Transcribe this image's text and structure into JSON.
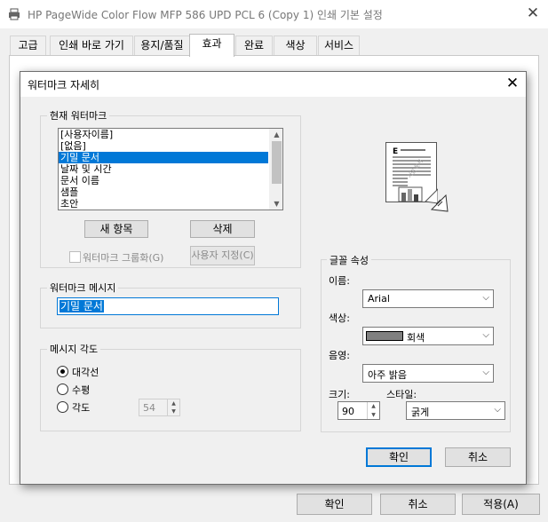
{
  "window": {
    "title": "HP PageWide Color Flow MFP 586 UPD PCL 6 (Copy 1) 인쇄 기본 설정",
    "close_glyph": "✕"
  },
  "tabs": [
    {
      "label": "고급"
    },
    {
      "label": "인쇄 바로 가기"
    },
    {
      "label": "용지/품질"
    },
    {
      "label": "효과"
    },
    {
      "label": "완료"
    },
    {
      "label": "색상"
    },
    {
      "label": "서비스"
    }
  ],
  "footer": {
    "ok": "확인",
    "cancel": "취소",
    "apply": "적용(A)"
  },
  "dialog": {
    "title": "워터마크 자세히",
    "close_glyph": "✕",
    "current": {
      "legend": "현재 워터마크",
      "items": [
        "[사용자이름]",
        "[없음]",
        "기밀 문서",
        "날짜 및 시간",
        "문서 이름",
        "샘플",
        "초안"
      ],
      "selected_index": 2,
      "new_button": "새 항목",
      "delete_button": "삭제",
      "group_checkbox": "워터마크 그룹화(G)",
      "group_checked": false,
      "custom_button": "사용자 지정(C)"
    },
    "message": {
      "legend": "워터마크 메시지",
      "value": "기밀 문서"
    },
    "angle": {
      "legend": "메시지 각도",
      "options": [
        "대각선",
        "수평",
        "각도"
      ],
      "selected": "대각선",
      "degrees": "54"
    },
    "font": {
      "legend": "글꼴 속성",
      "name_label": "이름:",
      "name_value": "Arial",
      "color_label": "색상:",
      "color_value": "회색",
      "color_swatch": "#808080",
      "shading_label": "음영:",
      "shading_value": "아주 밝음",
      "size_label": "크기:",
      "size_value": "90",
      "style_label": "스타일:",
      "style_value": "굵게"
    },
    "ok": "확인",
    "cancel": "취소"
  },
  "colors": {
    "accent": "#0078d7",
    "dialog_bg": "#f0f0f0"
  }
}
